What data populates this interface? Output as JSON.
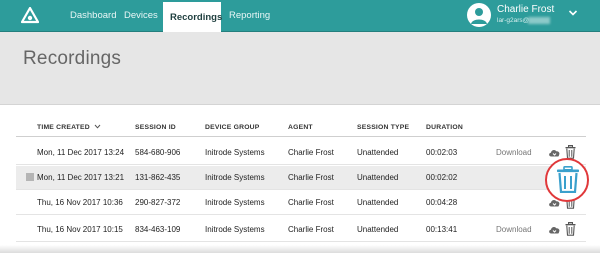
{
  "nav": {
    "items": [
      {
        "label": "Dashboard"
      },
      {
        "label": "Devices"
      },
      {
        "label": "Recordings",
        "active": true
      },
      {
        "label": "Reporting"
      }
    ]
  },
  "user": {
    "name": "Charlie Frost",
    "email": "lar-g2ars@"
  },
  "page": {
    "title": "Recordings"
  },
  "table": {
    "columns": [
      "TIME CREATED",
      "SESSION ID",
      "DEVICE GROUP",
      "AGENT",
      "SESSION TYPE",
      "DURATION"
    ],
    "rows": [
      {
        "time": "Mon, 11 Dec 2017 13:24",
        "session_id": "584-680-906",
        "device_group": "Initrode Systems",
        "agent": "Charlie Frost",
        "session_type": "Unattended",
        "duration": "00:02:03",
        "download": "Download"
      },
      {
        "time": "Mon, 11 Dec 2017 13:21",
        "session_id": "131-862-435",
        "device_group": "Initrode Systems",
        "agent": "Charlie Frost",
        "session_type": "Unattended",
        "duration": "00:02:02"
      },
      {
        "time": "Thu, 16 Nov 2017 10:36",
        "session_id": "290-827-372",
        "device_group": "Initrode Systems",
        "agent": "Charlie Frost",
        "session_type": "Unattended",
        "duration": "00:04:28"
      },
      {
        "time": "Thu, 16 Nov 2017 10:15",
        "session_id": "834-463-109",
        "device_group": "Initrode Systems",
        "agent": "Charlie Frost",
        "session_type": "Unattended",
        "duration": "00:13:41",
        "download": "Download"
      }
    ]
  },
  "colors": {
    "topbar": "#2d9c9b",
    "callout_ring": "#e0383a",
    "trash_highlight": "#3aa0cc"
  }
}
